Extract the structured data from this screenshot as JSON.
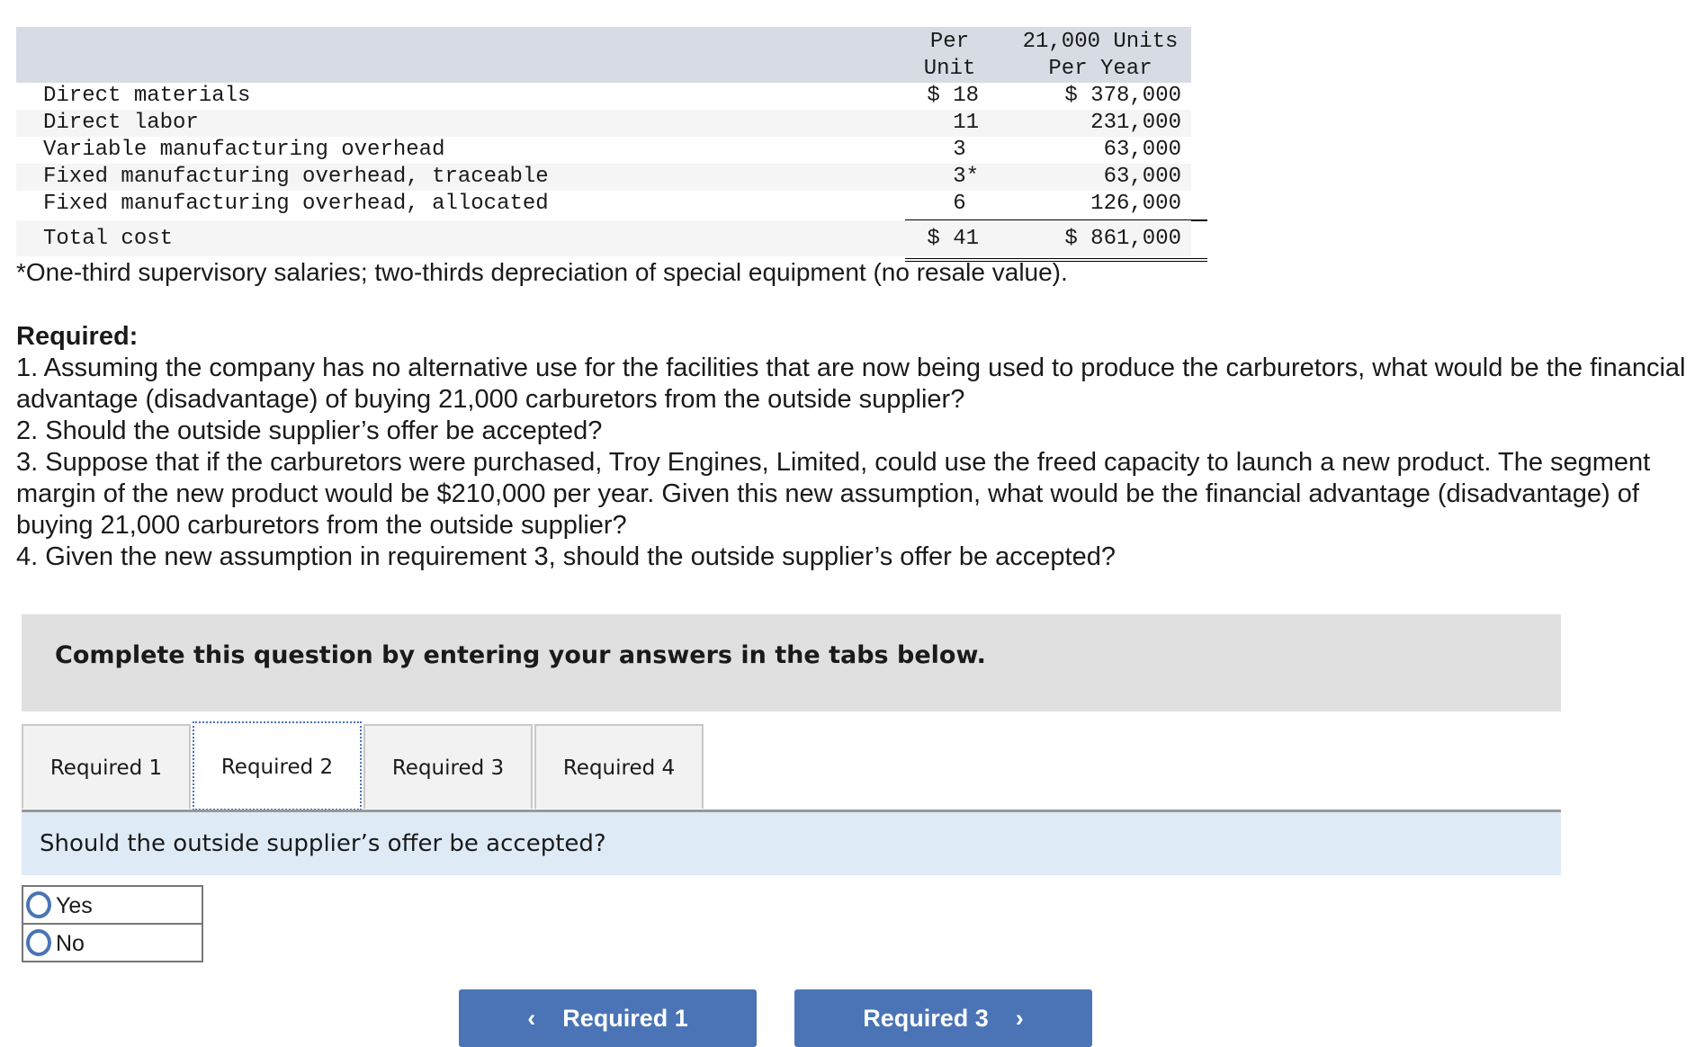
{
  "cost_table": {
    "headers": {
      "per_unit": [
        "Per",
        "Unit"
      ],
      "per_year": [
        "21,000 Units",
        "Per Year"
      ]
    },
    "rows": [
      {
        "label": "Direct materials",
        "per_unit": "$ 18",
        "per_year": "$ 378,000"
      },
      {
        "label": "Direct labor",
        "per_unit": "11",
        "per_year": "231,000"
      },
      {
        "label": "Variable manufacturing overhead",
        "per_unit": "3 ",
        "per_year": "63,000"
      },
      {
        "label": "Fixed manufacturing overhead, traceable",
        "per_unit": "3*",
        "per_year": "63,000"
      },
      {
        "label": "Fixed manufacturing overhead, allocated",
        "per_unit": "6 ",
        "per_year": "126,000"
      }
    ],
    "total": {
      "label": "Total cost",
      "per_unit": "$ 41",
      "per_year": "$ 861,000"
    }
  },
  "footnote": "*One-third supervisory salaries; two-thirds depreciation of special equipment (no resale value).",
  "required": {
    "title": "Required:",
    "items": [
      "1. Assuming the company has no alternative use for the facilities that are now being used to produce the carburetors, what would be the financial advantage (disadvantage) of buying 21,000 carburetors from the outside supplier?",
      "2. Should the outside supplier’s offer be accepted?",
      "3. Suppose that if the carburetors were purchased, Troy Engines, Limited, could use the freed capacity to launch a new product. The segment margin of the new product would be $210,000 per year. Given this new assumption, what would be the financial advantage (disadvantage) of buying 21,000 carburetors from the outside supplier?",
      "4. Given the new assumption in requirement 3, should the outside supplier’s offer be accepted?"
    ]
  },
  "instructions": "Complete this question by entering your answers in the tabs below.",
  "tabs": [
    {
      "label": "Required 1",
      "active": false
    },
    {
      "label": "Required 2",
      "active": true
    },
    {
      "label": "Required 3",
      "active": false
    },
    {
      "label": "Required 4",
      "active": false
    }
  ],
  "question": "Should the outside supplier’s offer be accepted?",
  "options": [
    "Yes",
    "No"
  ],
  "nav": {
    "prev_label": "Required 1",
    "next_label": "Required 3",
    "prev_icon": "chevron-left-icon",
    "next_icon": "chevron-right-icon"
  },
  "colors": {
    "accent": "#4a74b5",
    "header_bg": "#d7dce4",
    "panel_bg": "#deebf7",
    "instr_bg": "#e0e0e0"
  }
}
